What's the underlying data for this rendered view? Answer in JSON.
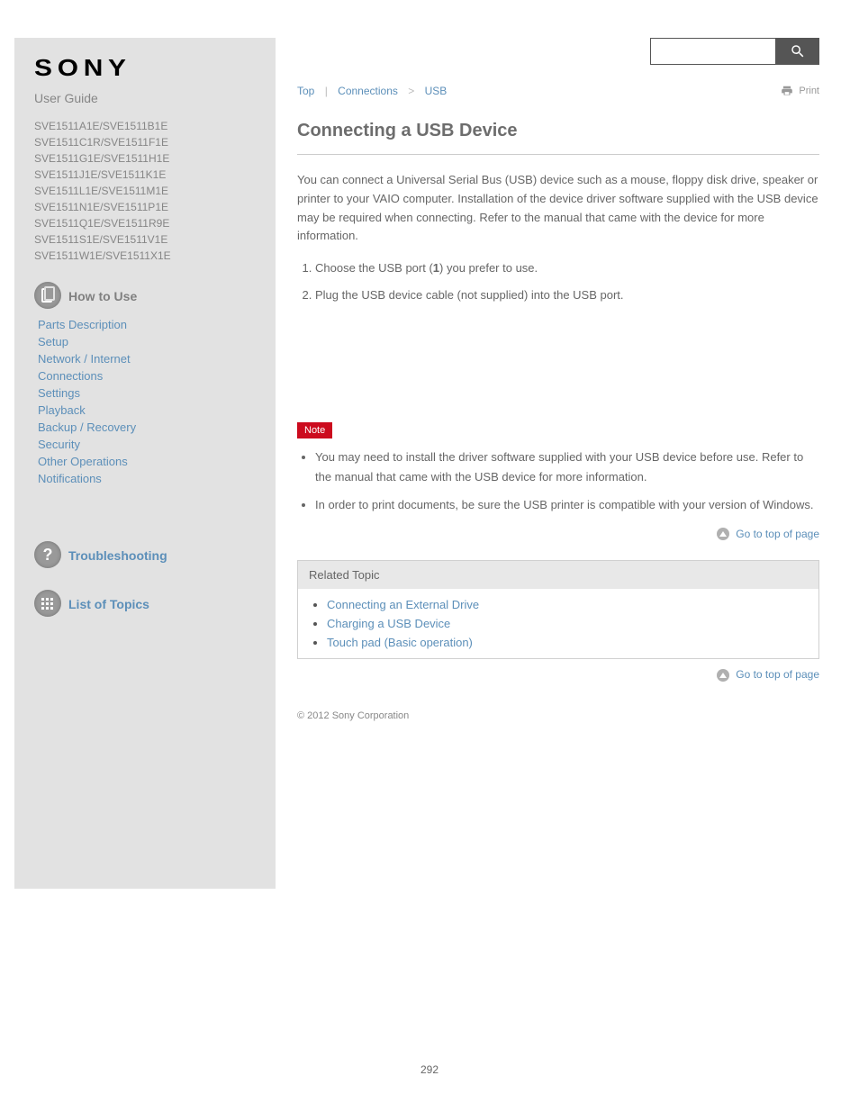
{
  "header": {
    "brand": "SONY",
    "guide": "User Guide",
    "models": [
      "SVE1511A1E/SVE1511B1E",
      "SVE1511C1R/SVE1511F1E",
      "SVE1511G1E/SVE1511H1E",
      "SVE1511J1E/SVE1511K1E",
      "SVE1511L1E/SVE1511M1E",
      "SVE1511N1E/SVE1511P1E",
      "SVE1511Q1E/SVE1511R9E",
      "SVE1511S1E/SVE1511V1E",
      "SVE1511W1E/SVE1511X1E"
    ]
  },
  "search": {
    "value": "",
    "submit_aria": "Search"
  },
  "sidebar": {
    "sections": [
      {
        "icon": "page",
        "title": "How to Use",
        "items": [
          "Parts Description",
          "Setup",
          "Network / Internet",
          "Connections",
          "Settings",
          "Playback",
          "Backup / Recovery",
          "Security",
          "Other Operations",
          "Notifications"
        ]
      },
      {
        "icon": "q",
        "title": "Troubleshooting",
        "items": []
      },
      {
        "icon": "list",
        "title": "List of Topics",
        "items": []
      }
    ]
  },
  "breadcrumbs": {
    "item0": "Top",
    "item1": "Connections",
    "item2": "USB"
  },
  "print": "Print",
  "article": {
    "title": "Connecting a USB Device",
    "para1": "You can connect a Universal Serial Bus (USB) device such as a mouse, floppy disk drive, speaker or printer to your VAIO computer. Installation of the device driver software supplied with the USB device may be required when connecting. Refer to the manual that came with the device for more information.",
    "step1_a": "Choose the USB port (",
    "step1_b": ") you prefer to use.",
    "step2": "Plug the USB device cable (not supplied) into the USB port.",
    "note_label": "Note",
    "notes": [
      "You may need to install the driver software supplied with your USB device before use. Refer to the manual that came with the USB device for more information.",
      "In order to print documents, be sure the USB printer is compatible with your version of Windows."
    ],
    "port_ref": "1"
  },
  "gotop": "Go to top of page",
  "related": {
    "header": "Related Topic",
    "links": [
      "Connecting an External Drive",
      "Charging a USB Device",
      "Touch pad (Basic operation)"
    ]
  },
  "copyright": "© 2012 Sony Corporation",
  "page_number": "292"
}
